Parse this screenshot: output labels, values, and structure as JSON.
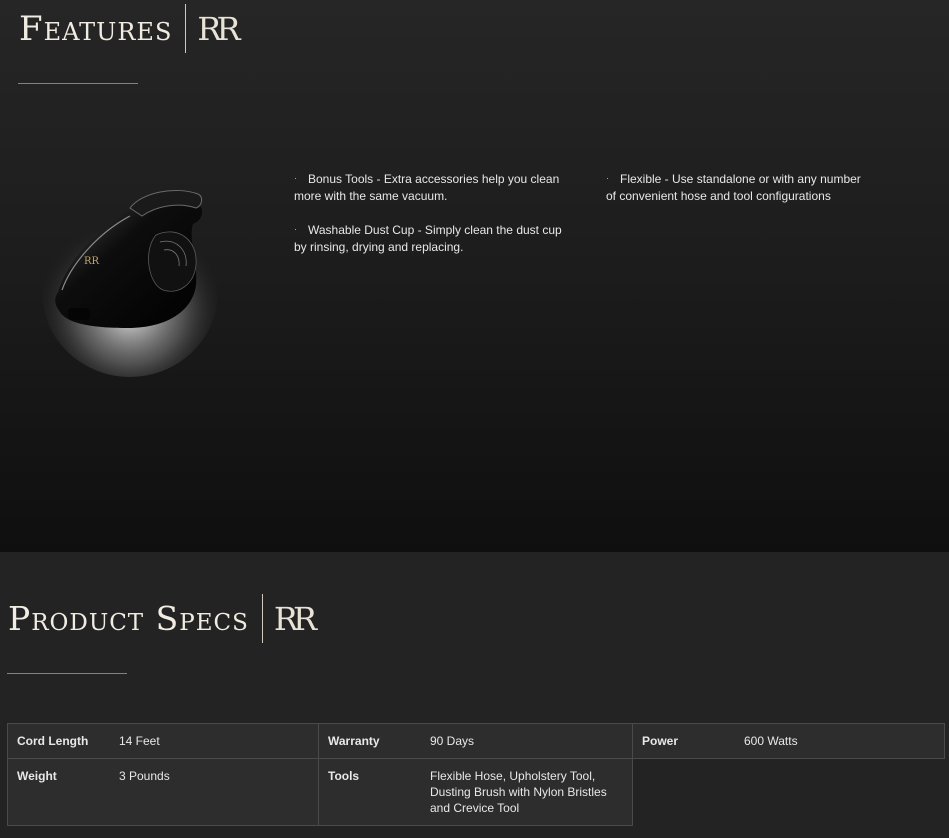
{
  "features": {
    "title": "Features",
    "brand_mark": "RR",
    "bullets_left": [
      "Bonus Tools - Extra accessories help you clean more with the same vacuum.",
      "Washable Dust Cup - Simply clean the dust cup by rinsing, drying and replacing."
    ],
    "bullets_right": [
      "Flexible - Use standalone or with any number of convenient hose and tool configurations"
    ],
    "image_label": "RR"
  },
  "specs": {
    "title": "Product Specs",
    "brand_mark": "RR",
    "rows": [
      [
        {
          "label": "Cord Length",
          "value": "14 Feet"
        },
        {
          "label": "Warranty",
          "value": "90 Days"
        },
        {
          "label": "Power",
          "value": "600 Watts"
        }
      ],
      [
        {
          "label": "Weight",
          "value": "3 Pounds"
        },
        {
          "label": "Tools",
          "value": "Flexible Hose, Upholstery Tool, Dusting Brush with Nylon Bristles and Crevice Tool"
        }
      ]
    ]
  },
  "colors": {
    "accent_gold": "#9c8145",
    "background_dark": "#0f0f0f",
    "table_cell": "#2d2d2d"
  }
}
